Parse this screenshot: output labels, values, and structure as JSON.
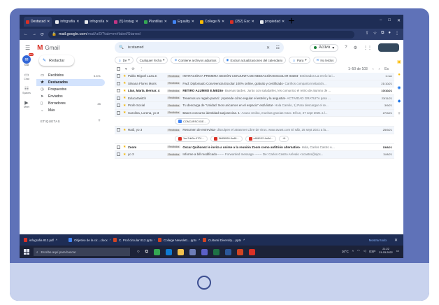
{
  "browser": {
    "tabs": [
      {
        "label": "Destacad",
        "color": "#d93025"
      },
      {
        "label": "infografía",
        "color": "#e8eaed"
      },
      {
        "label": "infografía",
        "color": "#e8eaed"
      },
      {
        "label": "(5) Instag",
        "color": "#c13584"
      },
      {
        "label": "Plantillas",
        "color": "#34a853"
      },
      {
        "label": "Equality",
        "color": "#4285f4"
      },
      {
        "label": "College N",
        "color": "#fbbc04"
      },
      {
        "label": "(252) Esc",
        "color": "#d93025"
      },
      {
        "label": "propiedad",
        "color": "#e8eaed"
      }
    ],
    "new_tab": "+",
    "url_domain": "mail.google.com",
    "url_rest": "/mail/u/0/?tab=rm#label/Starred"
  },
  "gmail": {
    "logo_text": "Gmail",
    "search_value": "is:starred",
    "status": "Activo",
    "compose_label": "Redactar",
    "rail": [
      {
        "label": "Mail",
        "icon": "mail-icon",
        "badge": "99+"
      },
      {
        "label": "Chat",
        "icon": "chat-icon"
      },
      {
        "label": "Spaces",
        "icon": "spaces-icon"
      },
      {
        "label": "Meet",
        "icon": "meet-icon"
      }
    ],
    "nav": [
      {
        "label": "Recibidos",
        "icon": "inbox-icon",
        "count": "5.871"
      },
      {
        "label": "Destacados",
        "icon": "star-icon",
        "count": ""
      },
      {
        "label": "Pospuestos",
        "icon": "clock-icon",
        "count": ""
      },
      {
        "label": "Enviados",
        "icon": "send-icon",
        "count": ""
      },
      {
        "label": "Borradores",
        "icon": "draft-icon",
        "count": "85"
      },
      {
        "label": "Más",
        "icon": "chevron-down-icon",
        "count": ""
      }
    ],
    "labels_heading": "ETIQUETAS",
    "chips": [
      {
        "label": "De",
        "icon": "person-icon"
      },
      {
        "label": "Cualquier fecha",
        "icon": ""
      },
      {
        "label": "Contiene archivos adjuntos",
        "icon": "attachment-icon"
      },
      {
        "label": "Excluir actualizaciones del calendario",
        "icon": "calendar-icon"
      },
      {
        "label": "Para",
        "icon": "person-icon"
      },
      {
        "label": "No leídos",
        "icon": "mail-icon"
      }
    ],
    "pagination": "1–50 de 103",
    "language": "Es",
    "emails": [
      {
        "from": "Pablo Miguel Luza Z.",
        "label": "Recibidos",
        "subject": "INVITACIÓN A PRIMERA SESIÓN CONJUNTA DE MEDIACIÓN ESCOLAR 03384",
        "snippet": " - Estimados La envío la i...",
        "date": "1 nov",
        "read": true
      },
      {
        "from": "Silvana Flores Moris",
        "label": "Recibidos",
        "subject": "Fwd: Diplomado Convivencia Escolar 100% online, gratuito y certificado",
        "snippet": " - Cariños comparto invitación...",
        "date": "21/10/21",
        "read": true
      },
      {
        "from": "Lian, María, Bernar. 4",
        "label": "Recibidos",
        "subject": "RETIRO ALUMNO E.MEDIA",
        "snippet": " - Buenas tardes. Junto con saludarles, les comunico el retiro de alumno de ...",
        "date": "10/10/21",
        "read": false
      },
      {
        "from": "EducaSwitch",
        "label": "Recibidos",
        "subject": "Tenemos un regalo para ti: ¡Aprende cómo regular el estrés y la angustia!",
        "snippet": " - ACTIVIDAD GRATUITA para ...",
        "date": "23/11/21",
        "read": true
      },
      {
        "from": "Profe Social",
        "label": "Recibidos",
        "subject": "Tu descarga de \"Unidad: Nos unicamos en el espacio\" está lista!",
        "snippet": " - Hola Camilo, 1) Para descargar el re...",
        "date": "3/9/21",
        "read": true
      },
      {
        "from": "Carolina, Lorena, yo 3",
        "label": "Recibidos",
        "subject": "Bases concurso identidad sanjosecina. 1",
        "snippet": " - Acuso recibo, muchas gracias Caro. El lun, 27 sept 2021 a l...",
        "date": "27/9/21",
        "read": true,
        "attachments": [
          {
            "name": "CONCURSO IDE...",
            "color": "#4285f4"
          }
        ]
      },
      {
        "from": "Raúl, yo 3",
        "label": "Recibidos",
        "subject": "Resumen de entrevista",
        "snippet": " - disculpen el atrasmer Libre de virus. www.avast.com El sáb, 25 sept 2021 a la...",
        "date": "25/9/21",
        "read": true,
        "attachments": [
          {
            "name": "1ee7dd0e-9701...",
            "color": "#d93025"
          },
          {
            "name": "5b55f060-9a48...",
            "color": "#d93025"
          },
          {
            "name": "eff46102-4a5d...",
            "color": "#d93025"
          },
          {
            "name": "+6",
            "color": ""
          }
        ]
      },
      {
        "from": "Zoom",
        "label": "Recibidos",
        "subject": "Oscar Quiñonez le invita a unirse a la reunión Zoom como anfitrión alternativo",
        "snippet": " - Hola, Carlos Castro A...",
        "date": "15/8/21",
        "read": false
      },
      {
        "from": "yo 3",
        "label": "Recibidos",
        "subject": "Informe a bill modificado",
        "snippet": " ------- Forwarded message ------- De: Carlos Castro Arévalo <ccastro@sjcs...",
        "date": "11/8/21",
        "read": true
      }
    ]
  },
  "downloads": [
    {
      "name": "infografia 812.pdf",
      "color": "#d93025"
    },
    {
      "name": "Objetivo de la cir....docx",
      "color": "#4285f4"
    },
    {
      "name": "C. Prof circular 812.pptx",
      "color": "#d04423"
    },
    {
      "name": "College Newslett....pptx",
      "color": "#d04423"
    },
    {
      "name": "Cultural Diversity....pptx",
      "color": "#d04423"
    }
  ],
  "downloads_show_all": "Mostrar todo",
  "taskbar": {
    "search_placeholder": "Escribe aquí para buscar",
    "weather": "16°C",
    "lang": "ESP",
    "time": "21:22",
    "date": "21-03-2022"
  }
}
